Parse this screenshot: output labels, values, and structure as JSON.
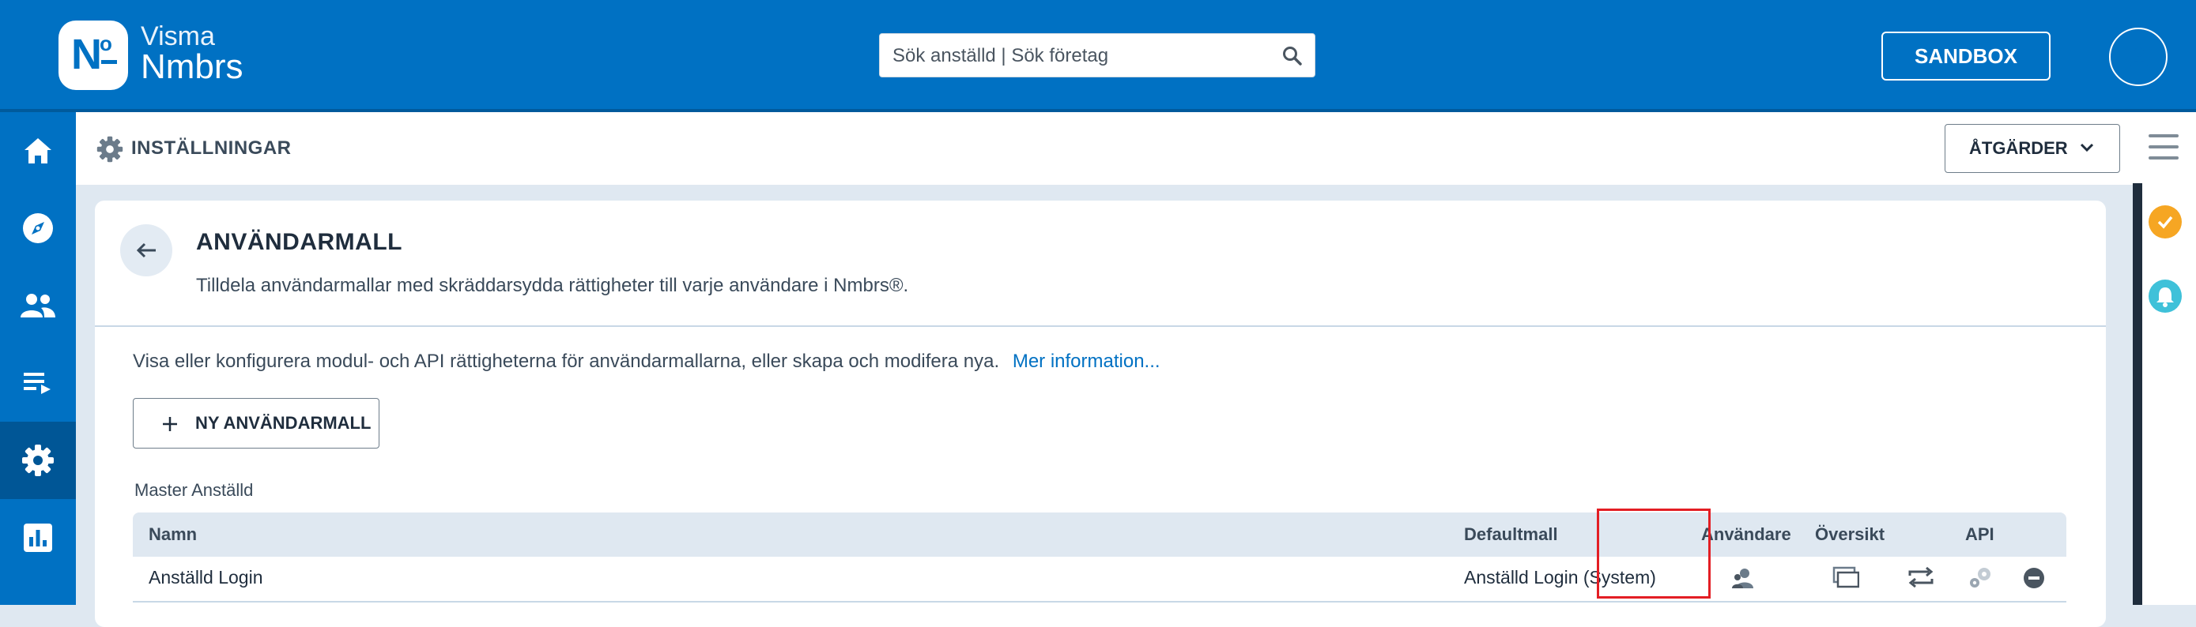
{
  "header": {
    "logo_mark": "N",
    "logo_sup": "o",
    "brand_line1": "Visma",
    "brand_line2": "Nmbrs",
    "search_placeholder": "Sök anställd | Sök företag",
    "sandbox_label": "SANDBOX"
  },
  "leftnav": {
    "items": [
      {
        "name": "home-icon",
        "active": false
      },
      {
        "name": "compass-icon",
        "active": false
      },
      {
        "name": "people-icon",
        "active": false
      },
      {
        "name": "list-icon",
        "active": false
      },
      {
        "name": "gear-icon",
        "active": true
      },
      {
        "name": "bar-chart-icon",
        "active": false
      }
    ]
  },
  "settings": {
    "title": "INSTÄLLNINGAR",
    "actions_label": "ÅTGÄRDER"
  },
  "card": {
    "title": "ANVÄNDARMALL",
    "subtitle": "Tilldela användarmallar med skräddarsydda rättigheter till varje användare i Nmbrs®.",
    "info_text": "Visa eller konfigurera modul- och API rättigheterna för användarmallarna, eller skapa och modifera nya.",
    "info_link": "Mer information...",
    "new_button": "NY ANVÄNDARMALL",
    "group_label": "Master Anställd",
    "table": {
      "headers": {
        "name": "Namn",
        "default": "Defaultmall",
        "users": "Användare",
        "overview": "Översikt",
        "api": "API"
      },
      "rows": [
        {
          "name": "Anställd Login",
          "default": "Anställd Login (System)"
        }
      ]
    }
  },
  "colors": {
    "brand_blue": "#0071c3",
    "nav_active": "#005696",
    "notif_orange": "#f6a623",
    "notif_teal": "#3fc1d9",
    "highlight_red": "#e31e24"
  }
}
